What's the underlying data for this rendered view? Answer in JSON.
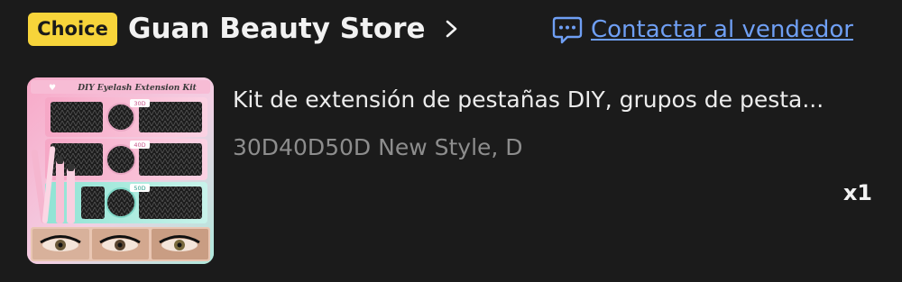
{
  "header": {
    "badge_label": "Choice",
    "store_name": "Guan Beauty Store",
    "contact_label": "Contactar al vendedor"
  },
  "product": {
    "title": "Kit de extensión de pestañas DIY, grupos de pesta...",
    "variant": "30D40D50D New Style, D",
    "quantity": "x1",
    "image": {
      "box_title": "DIY Eyelash Extension Kit",
      "label_top": "30D",
      "label_mid": "40D",
      "label_bottom": "50D"
    }
  },
  "colors": {
    "background": "#1b1b1b",
    "badge": "#f7d43a",
    "link": "#6f9ff4",
    "muted_text": "#8d8d8d"
  }
}
